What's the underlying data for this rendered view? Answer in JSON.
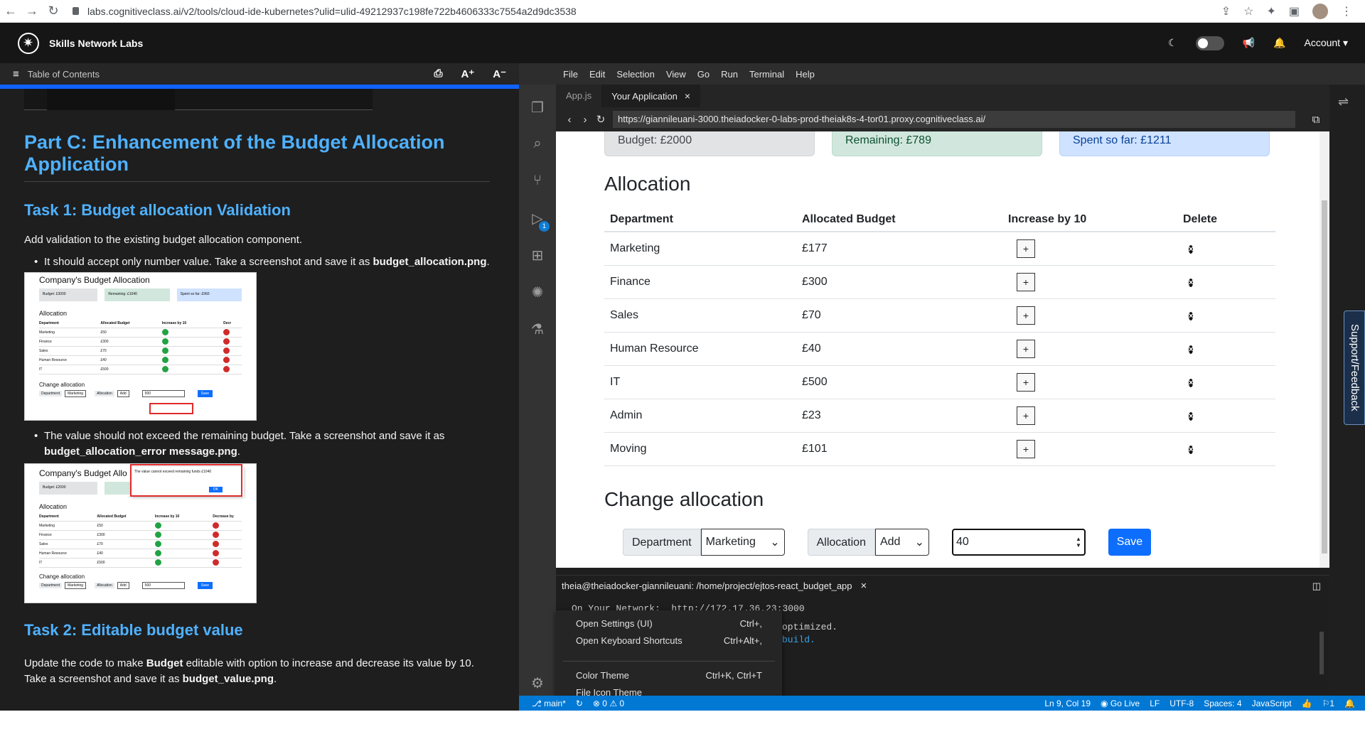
{
  "browser": {
    "url": "labs.cognitiveclass.ai/v2/tools/cloud-ide-kubernetes?ulid=ulid-49212937c198fe722b4606333c7554a2d9dc3538"
  },
  "header": {
    "title": "Skills Network Labs",
    "account": "Account"
  },
  "toc": {
    "label": "Table of Contents",
    "font_up": "A⁺",
    "font_down": "A⁻"
  },
  "doc": {
    "part_title": "Part C: Enhancement of the Budget Allocation Application",
    "task1_title": "Task 1: Budget allocation Validation",
    "task1_intro": "Add validation to the existing budget allocation component.",
    "task1_bullet1": "It should accept only number value. Take a screenshot and save it as",
    "task1_bullet1_file": "budget_allocation.png",
    "task1_bullet2": "The value should not exceed the remaining budget. Take a screenshot and save it as",
    "task1_bullet2_file": "budget_allocation_error message.png",
    "task2_title": "Task 2: Editable budget value",
    "task2_text_a": "Update the code to make",
    "task2_text_bold": "Budget",
    "task2_text_b": "editable with option to increase and decrease its value by 10.",
    "task2_text_c": "Take a screenshot and save it as",
    "task2_file": "budget_value.png",
    "thumb1": {
      "title": "Company's Budget Allocation",
      "budget": "Budget: £3000",
      "remaining": "Remaining: £1040",
      "spent": "Spent so far: £960",
      "allocation": "Allocation",
      "headers": [
        "Department",
        "Allocated Budget",
        "Increase by 10",
        "Decr"
      ],
      "rows": [
        [
          "Marketing",
          "£50"
        ],
        [
          "Finance",
          "£300"
        ],
        [
          "Sales",
          "£70"
        ],
        [
          "Human Resource",
          "£40"
        ],
        [
          "IT",
          "£500"
        ]
      ],
      "change": "Change allocation",
      "department": "Department",
      "dept_val": "Marketing",
      "allocation_lbl": "Allocation",
      "add": "Add",
      "input_val": "500",
      "save": "Save"
    },
    "thumb2": {
      "title": "Company's Budget Allo",
      "budget": "Budget: £2000",
      "dialog_text": "The value cannot exceed remaining funds £1040",
      "ok": "OK",
      "allocation": "Allocation",
      "headers": [
        "Department",
        "Allocated Budget",
        "Increase by 10",
        "Decrease by"
      ],
      "rows": [
        [
          "Marketing",
          "£50"
        ],
        [
          "Finance",
          "£300"
        ],
        [
          "Sales",
          "£70"
        ],
        [
          "Human Resource",
          "£40"
        ],
        [
          "IT",
          "£500"
        ]
      ],
      "change": "Change allocation",
      "department": "Department",
      "dept_val": "Marketing",
      "allocation_lbl": "Allocation",
      "add": "Add",
      "input_val": "500",
      "save": "Save"
    }
  },
  "ide": {
    "menu": [
      "File",
      "Edit",
      "Selection",
      "View",
      "Go",
      "Run",
      "Terminal",
      "Help"
    ],
    "tabs": [
      {
        "label": "App.js"
      },
      {
        "label": "Your Application"
      }
    ],
    "preview_url": "https://giannileuani-3000.theiadocker-0-labs-prod-theiak8s-4-tor01.proxy.cognitiveclass.ai/",
    "scm_badge": "1"
  },
  "app": {
    "budget": "Budget: £2000",
    "remaining": "Remaining: £789",
    "spent": "Spent so far: £1211",
    "allocation_title": "Allocation",
    "headers": [
      "Department",
      "Allocated Budget",
      "Increase by 10",
      "Delete"
    ],
    "rows": [
      {
        "dept": "Marketing",
        "amount": "£177"
      },
      {
        "dept": "Finance",
        "amount": "£300"
      },
      {
        "dept": "Sales",
        "amount": "£70"
      },
      {
        "dept": "Human Resource",
        "amount": "£40"
      },
      {
        "dept": "IT",
        "amount": "£500"
      },
      {
        "dept": "Admin",
        "amount": "£23"
      },
      {
        "dept": "Moving",
        "amount": "£101"
      }
    ],
    "change_title": "Change allocation",
    "department_label": "Department",
    "department_value": "Marketing",
    "allocation_label": "Allocation",
    "allocation_value": "Add",
    "amount_value": "40",
    "save": "Save",
    "plus": "+"
  },
  "terminal": {
    "tab_label": "theia@theiadocker-giannileuani: /home/project/ejtos-react_budget_app",
    "line1": "On Your Network:  http://172.17.36.23:3000",
    "line2_tail": "optimized.",
    "line3_tail": "build."
  },
  "context_menu": {
    "items": [
      {
        "label": "Open Settings (UI)",
        "shortcut": "Ctrl+,"
      },
      {
        "label": "Open Keyboard Shortcuts",
        "shortcut": "Ctrl+Alt+,"
      },
      {
        "label": "Color Theme",
        "shortcut": "Ctrl+K, Ctrl+T"
      },
      {
        "label": "File Icon Theme",
        "shortcut": ""
      }
    ]
  },
  "statusbar": {
    "branch": "main*",
    "problems": "⊗ 0 ⚠ 0",
    "position": "Ln 9, Col 19",
    "golive": "Go Live",
    "eol": "LF",
    "encoding": "UTF-8",
    "spaces": "Spaces: 4",
    "language": "JavaScript",
    "notifications": "1"
  },
  "support": "Support/Feedback"
}
